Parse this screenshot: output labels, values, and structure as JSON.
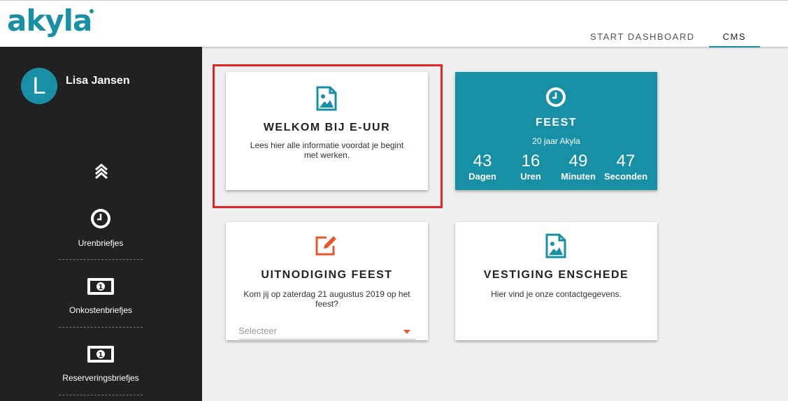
{
  "brand": {
    "logo_text": "akyla",
    "color": "#1790a6"
  },
  "nav": {
    "tabs": [
      {
        "label": "START DASHBOARD",
        "active": false
      },
      {
        "label": "CMS",
        "active": true
      }
    ]
  },
  "user": {
    "initial": "L",
    "name": "Lisa Jansen"
  },
  "sidebar": {
    "collapse_icon": "double-chevron-up-icon",
    "items": [
      {
        "label": "Urenbriefjes",
        "icon": "clock-icon"
      },
      {
        "label": "Onkostenbriefjes",
        "icon": "banknote-icon"
      },
      {
        "label": "Reserveringsbriefjes",
        "icon": "banknote-icon"
      }
    ]
  },
  "cards": {
    "welkom": {
      "icon": "image-file-icon",
      "title": "WELKOM BIJ E-UUR",
      "text": "Lees hier alle informatie voordat je begint met werken.",
      "highlighted": true,
      "highlight_color": "#e02428"
    },
    "feest": {
      "icon": "clock-icon",
      "title": "FEEST",
      "subtitle": "20 jaar Akyla",
      "countdown": [
        {
          "value": "43",
          "label": "Dagen"
        },
        {
          "value": "16",
          "label": "Uren"
        },
        {
          "value": "49",
          "label": "Minuten"
        },
        {
          "value": "47",
          "label": "Seconden"
        }
      ],
      "bg_color": "#1790a6"
    },
    "uitnodiging": {
      "icon": "edit-icon",
      "icon_color": "#e8552a",
      "title": "UITNODIGING FEEST",
      "text": "Kom jij op zaterdag 21 augustus 2019 op het feest?",
      "select_placeholder": "Selecteer"
    },
    "vestiging": {
      "icon": "image-file-icon",
      "title": "VESTIGING ENSCHEDE",
      "text": "Hier vind je onze contactgegevens."
    }
  }
}
